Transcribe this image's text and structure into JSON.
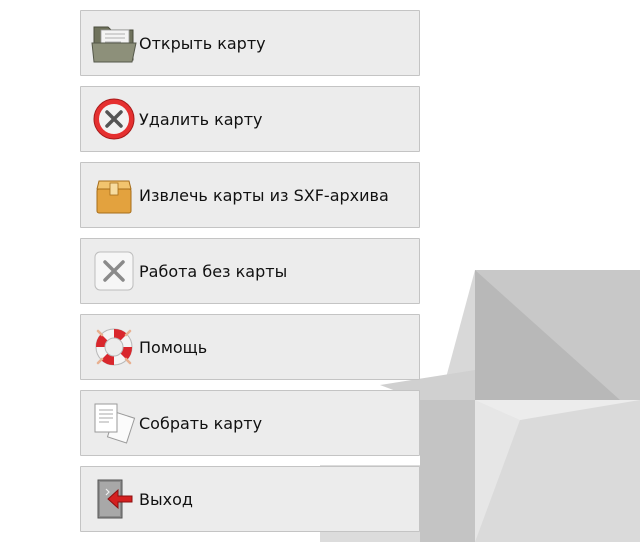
{
  "menu": {
    "items": [
      {
        "label": "Открыть карту",
        "icon": "folder-icon"
      },
      {
        "label": "Удалить карту",
        "icon": "delete-icon"
      },
      {
        "label": "Извлечь карты из SXF-архива",
        "icon": "archive-box-icon"
      },
      {
        "label": "Работа без карты",
        "icon": "close-icon"
      },
      {
        "label": "Помощь",
        "icon": "lifebuoy-icon"
      },
      {
        "label": "Собрать карту",
        "icon": "documents-icon"
      },
      {
        "label": "Выход",
        "icon": "exit-door-icon"
      }
    ]
  },
  "colors": {
    "button_bg": "#ececec",
    "button_border": "#c4c4c4",
    "logo_light": "#dcdcdc",
    "logo_mid": "#c8c8c8",
    "logo_dark": "#b4b4b4",
    "delete_red": "#d8262a",
    "exit_red": "#d42020"
  }
}
